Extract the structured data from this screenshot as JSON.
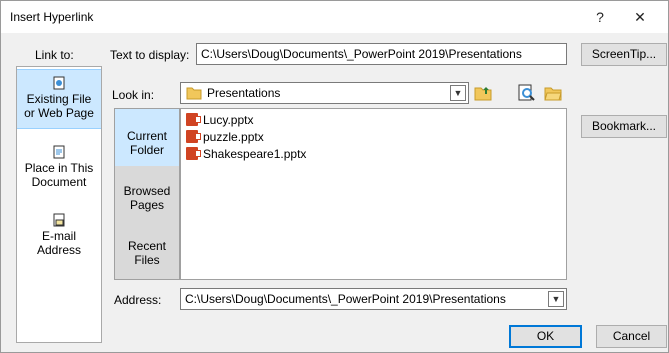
{
  "window": {
    "title": "Insert Hyperlink",
    "help_icon": "?",
    "close_icon": "✕"
  },
  "link_to": {
    "label": "Link to:",
    "items": [
      {
        "line1": "Existing File",
        "line2": "or Web Page",
        "icon": "web-page-icon",
        "selected": true
      },
      {
        "line1": "Place in This",
        "line2": "Document",
        "icon": "document-icon",
        "selected": false
      },
      {
        "line1": "E-mail",
        "line2": "Address",
        "icon": "email-icon",
        "selected": false
      }
    ]
  },
  "text_to_display": {
    "label": "Text to display:",
    "value": "C:\\Users\\Doug\\Documents\\_PowerPoint 2019\\Presentations"
  },
  "look_in": {
    "label": "Look in:",
    "value": "Presentations"
  },
  "nav": {
    "items": [
      {
        "line1": "Current",
        "line2": "Folder",
        "selected": true
      },
      {
        "line1": "Browsed",
        "line2": "Pages",
        "selected": false
      },
      {
        "line1": "Recent",
        "line2": "Files",
        "selected": false
      }
    ]
  },
  "files": [
    "Lucy.pptx",
    "puzzle.pptx",
    "Shakespeare1.pptx"
  ],
  "address": {
    "label": "Address:",
    "value": "C:\\Users\\Doug\\Documents\\_PowerPoint 2019\\Presentations"
  },
  "buttons": {
    "screentip": "ScreenTip...",
    "bookmark": "Bookmark...",
    "ok": "OK",
    "cancel": "Cancel"
  },
  "colors": {
    "selected_bg": "#cce8ff",
    "ppt_red": "#d04423",
    "accent": "#0078d7"
  }
}
